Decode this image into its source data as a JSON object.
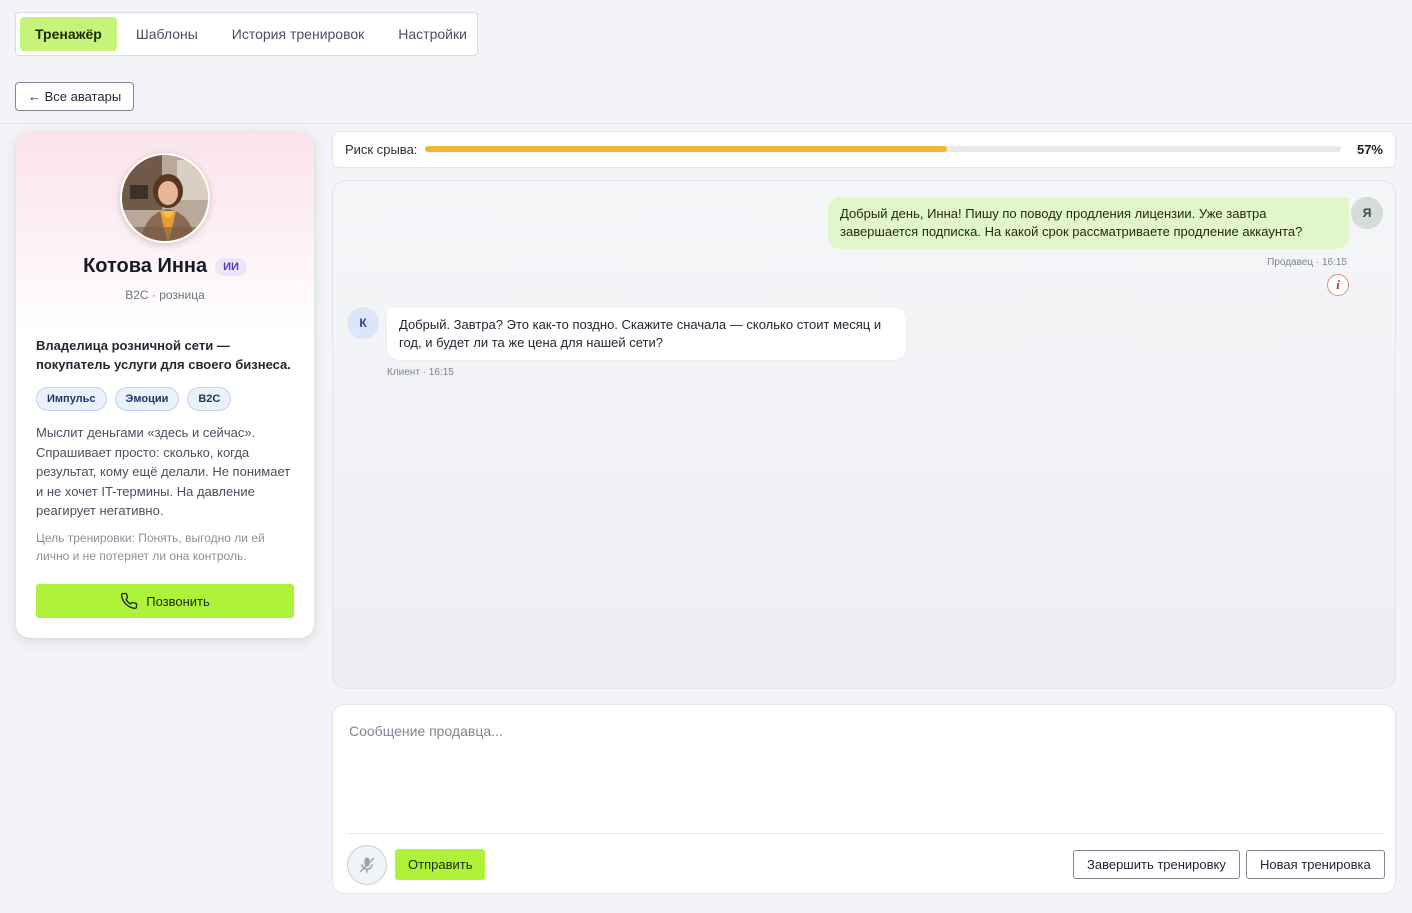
{
  "tabs": [
    {
      "label": "Тренажёр",
      "active": true
    },
    {
      "label": "Шаблоны",
      "active": false
    },
    {
      "label": "История тренировок",
      "active": false
    },
    {
      "label": "Настройки",
      "active": false
    }
  ],
  "back_label": "← Все аватары",
  "profile": {
    "name": "Котова Инна",
    "badge": "ИИ",
    "segment": "B2C · розница",
    "role": "Владелица розничной сети — покупатель услуги для своего бизнеса.",
    "tags": [
      "Импульс",
      "Эмоции",
      "B2C"
    ],
    "description": "Мыслит деньгами «здесь и сейчас». Спрашивает просто: сколько, когда результат, кому ещё делали. Не понимает и не хочет IT-термины. На давление реагирует негативно.",
    "goal": "Цель тренировки: Понять, выгодно ли ей лично и не потеряет ли она контроль.",
    "call_label": "Позвонить"
  },
  "risk": {
    "label": "Риск срыва:",
    "value_text": "57%",
    "value": 57,
    "color": "#f2b630"
  },
  "chat": {
    "messages": [
      {
        "sender": "me",
        "avatar": "Я",
        "text": "Добрый день, Инна! Пишу по поводу продления лицензии. Уже завтра завершается подписка. На какой срок рассматриваете продление аккаунта?",
        "meta": "Продавец · 16:15"
      },
      {
        "sender": "client",
        "avatar": "К",
        "text": "Добрый. Завтра? Это как-то поздно. Скажите сначала — сколько стоит месяц и год, и будет ли та же цена для нашей сети?",
        "meta": "Клиент · 16:15"
      }
    ],
    "info_symbol": "i"
  },
  "composer": {
    "placeholder": "Сообщение продавца...",
    "value": "",
    "send_label": "Отправить",
    "finish_label": "Завершить тренировку",
    "new_label": "Новая тренировка"
  },
  "colors": {
    "accent": "#aef23a",
    "active_tab": "#c6f37a",
    "seller_bubble": "#e2f7c9"
  }
}
